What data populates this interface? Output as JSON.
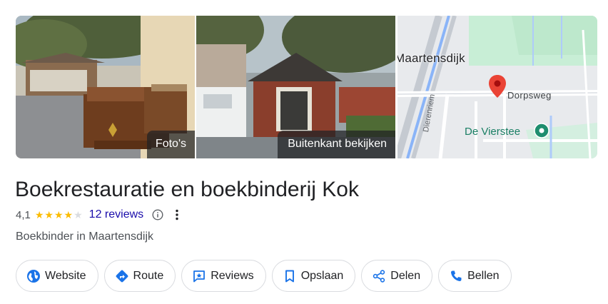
{
  "tiles": {
    "photos_label": "Foto's",
    "exterior_label": "Buitenkant bekijken",
    "map": {
      "town": "Maartensdijk",
      "street": "Dorpsweg",
      "poi": "De Vierstee",
      "side_street": "Dierenriem"
    }
  },
  "place": {
    "name": "Boekrestauratie en boekbinderij Kok",
    "rating": "4,1",
    "rating_value": 4.1,
    "rating_max": 5,
    "reviews_label": "12 reviews",
    "category": "Boekbinder in Maartensdijk"
  },
  "actions": [
    {
      "label": "Website",
      "icon": "globe-icon"
    },
    {
      "label": "Route",
      "icon": "directions-icon"
    },
    {
      "label": "Reviews",
      "icon": "review-icon"
    },
    {
      "label": "Opslaan",
      "icon": "bookmark-icon"
    },
    {
      "label": "Delen",
      "icon": "share-icon"
    },
    {
      "label": "Bellen",
      "icon": "phone-icon"
    }
  ],
  "colors": {
    "accent_blue": "#1a73e8",
    "link_blue": "#1a0dab",
    "star_yellow": "#fbbc04",
    "pin_red": "#ea4335",
    "poi_green": "#1e8e6e"
  }
}
